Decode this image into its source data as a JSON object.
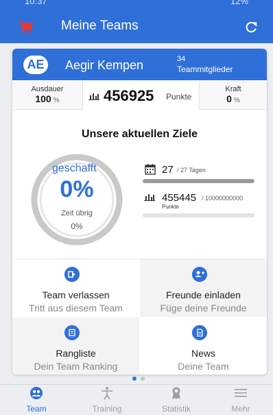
{
  "statusbar": {
    "time": "10:37",
    "right": "12%"
  },
  "appbar": {
    "title": "Meine Teams",
    "icons": [
      "cart-icon",
      "refresh-icon"
    ]
  },
  "team": {
    "initials": "AE",
    "member_name": "Aegir Kempen",
    "member_count": "34",
    "member_count_label": "Teammitglieder"
  },
  "stats": {
    "ausdauer_label": "Ausdauer",
    "ausdauer_value": "100",
    "ausdauer_unit": "%",
    "points_value": "456925",
    "points_label": "Punkte",
    "kraft_label": "Kraft",
    "kraft_value": "0",
    "kraft_unit": "%"
  },
  "goals": {
    "title": "Unsere aktuellen Ziele",
    "done_label": "geschafft",
    "done_percent": "0%",
    "time_left_label": "Zeit übrig",
    "time_left_value": "0%",
    "days_value": "27",
    "days_total": "/ 27 Tagen",
    "days_progress": 1.0,
    "points_value": "455445",
    "points_total": "/ 10000000000",
    "points_label": "Punkte",
    "points_progress": 0.0
  },
  "actions": [
    {
      "title": "Team verlassen",
      "subtitle": "Tritt aus diesem Team",
      "icon": "exit-icon"
    },
    {
      "title": "Freunde einladen",
      "subtitle": "Füge deine Freunde",
      "icon": "add-user-icon"
    },
    {
      "title": "Rangliste",
      "subtitle": "Dein Team Ranking",
      "icon": "list-icon"
    },
    {
      "title": "News",
      "subtitle": "Deine Team",
      "icon": "news-icon"
    }
  ],
  "nav": [
    {
      "label": "Team",
      "icon": "team-icon",
      "active": true
    },
    {
      "label": "Training",
      "icon": "training-icon",
      "active": false
    },
    {
      "label": "Statistik",
      "icon": "statistik-icon",
      "active": false
    },
    {
      "label": "Mehr",
      "icon": "menu-icon",
      "active": false
    }
  ],
  "colors": {
    "primary": "#2f6fd8",
    "cart": "#e53935",
    "inactive": "#9e9e9e"
  }
}
